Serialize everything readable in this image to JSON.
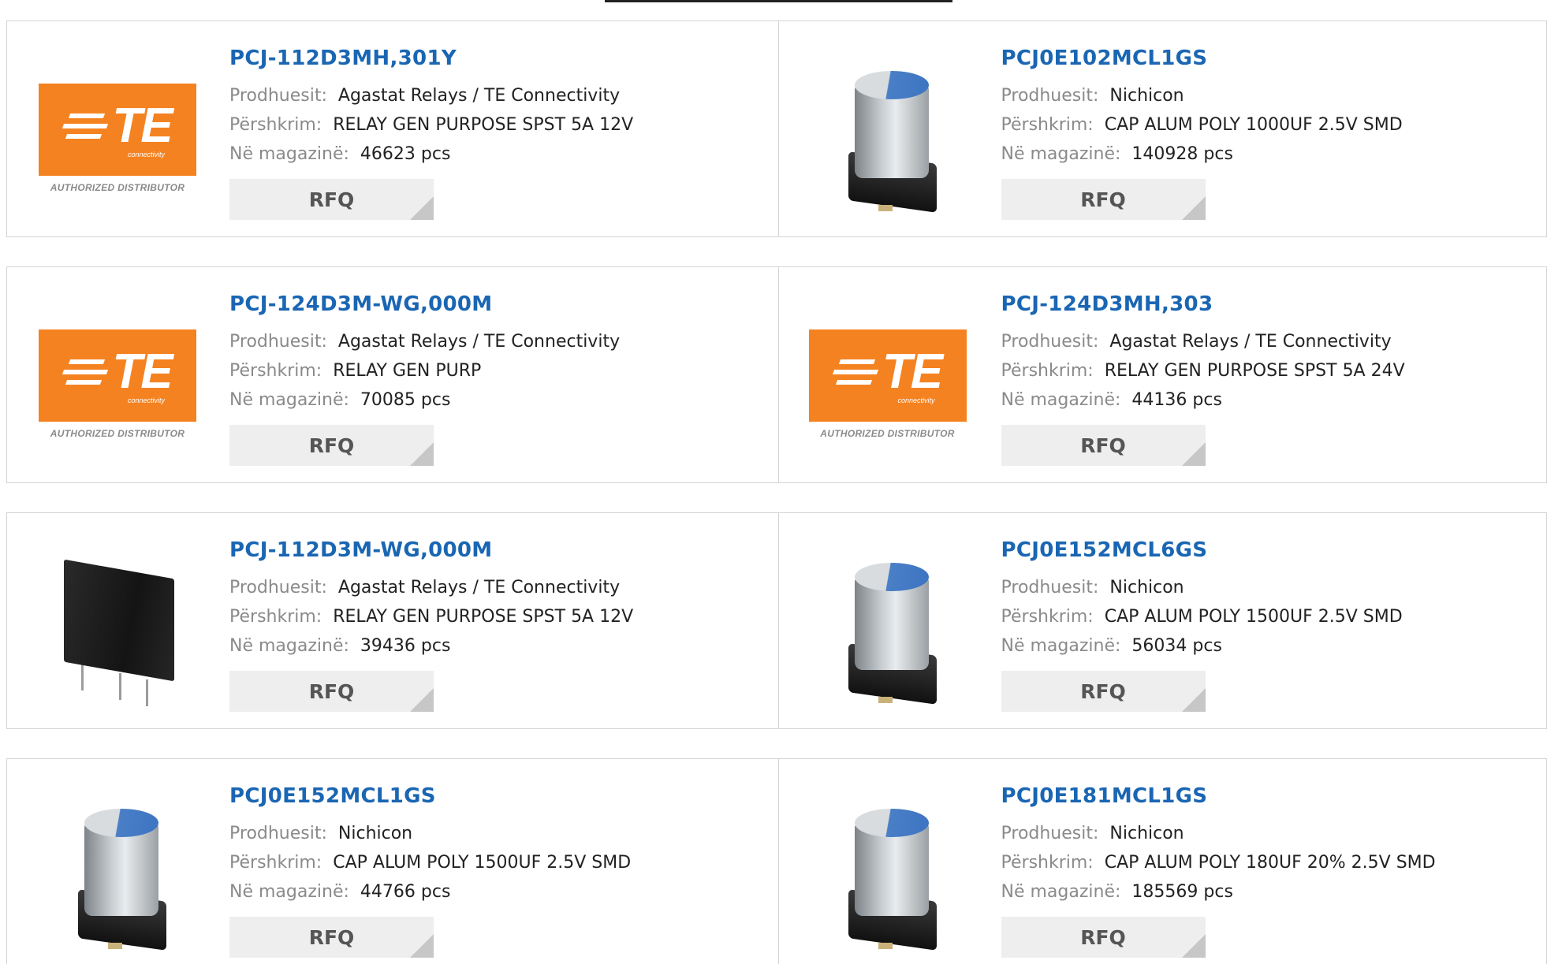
{
  "labels": {
    "manufacturer": "Prodhuesit:",
    "description": "Përshkrim:",
    "stock": "Në magazinë:",
    "rfq": "RFQ"
  },
  "logo": {
    "brand": "TE",
    "sub": "connectivity",
    "caption": "AUTHORIZED DISTRIBUTOR",
    "color": "#f58220"
  },
  "colors": {
    "link": "#1a66b3",
    "button_bg": "#eeeeee"
  },
  "products": [
    {
      "part": "PCJ-112D3MH,301Y",
      "manufacturer": "Agastat Relays / TE Connectivity",
      "description": "RELAY GEN PURPOSE SPST 5A 12V",
      "stock": "46623 pcs",
      "image": "te-logo"
    },
    {
      "part": "PCJ0E102MCL1GS",
      "manufacturer": "Nichicon",
      "description": "CAP ALUM POLY 1000UF 2.5V SMD",
      "stock": "140928 pcs",
      "image": "capacitor"
    },
    {
      "part": "PCJ-124D3M-WG,000M",
      "manufacturer": "Agastat Relays / TE Connectivity",
      "description": "RELAY GEN PURP",
      "stock": "70085 pcs",
      "image": "te-logo"
    },
    {
      "part": "PCJ-124D3MH,303",
      "manufacturer": "Agastat Relays / TE Connectivity",
      "description": "RELAY GEN PURPOSE SPST 5A 24V",
      "stock": "44136 pcs",
      "image": "te-logo"
    },
    {
      "part": "PCJ-112D3M-WG,000M",
      "manufacturer": "Agastat Relays / TE Connectivity",
      "description": "RELAY GEN PURPOSE SPST 5A 12V",
      "stock": "39436 pcs",
      "image": "relay"
    },
    {
      "part": "PCJ0E152MCL6GS",
      "manufacturer": "Nichicon",
      "description": "CAP ALUM POLY 1500UF 2.5V SMD",
      "stock": "56034 pcs",
      "image": "capacitor"
    },
    {
      "part": "PCJ0E152MCL1GS",
      "manufacturer": "Nichicon",
      "description": "CAP ALUM POLY 1500UF 2.5V SMD",
      "stock": "44766 pcs",
      "image": "capacitor"
    },
    {
      "part": "PCJ0E181MCL1GS",
      "manufacturer": "Nichicon",
      "description": "CAP ALUM POLY 180UF 20% 2.5V SMD",
      "stock": "185569 pcs",
      "image": "capacitor"
    }
  ]
}
